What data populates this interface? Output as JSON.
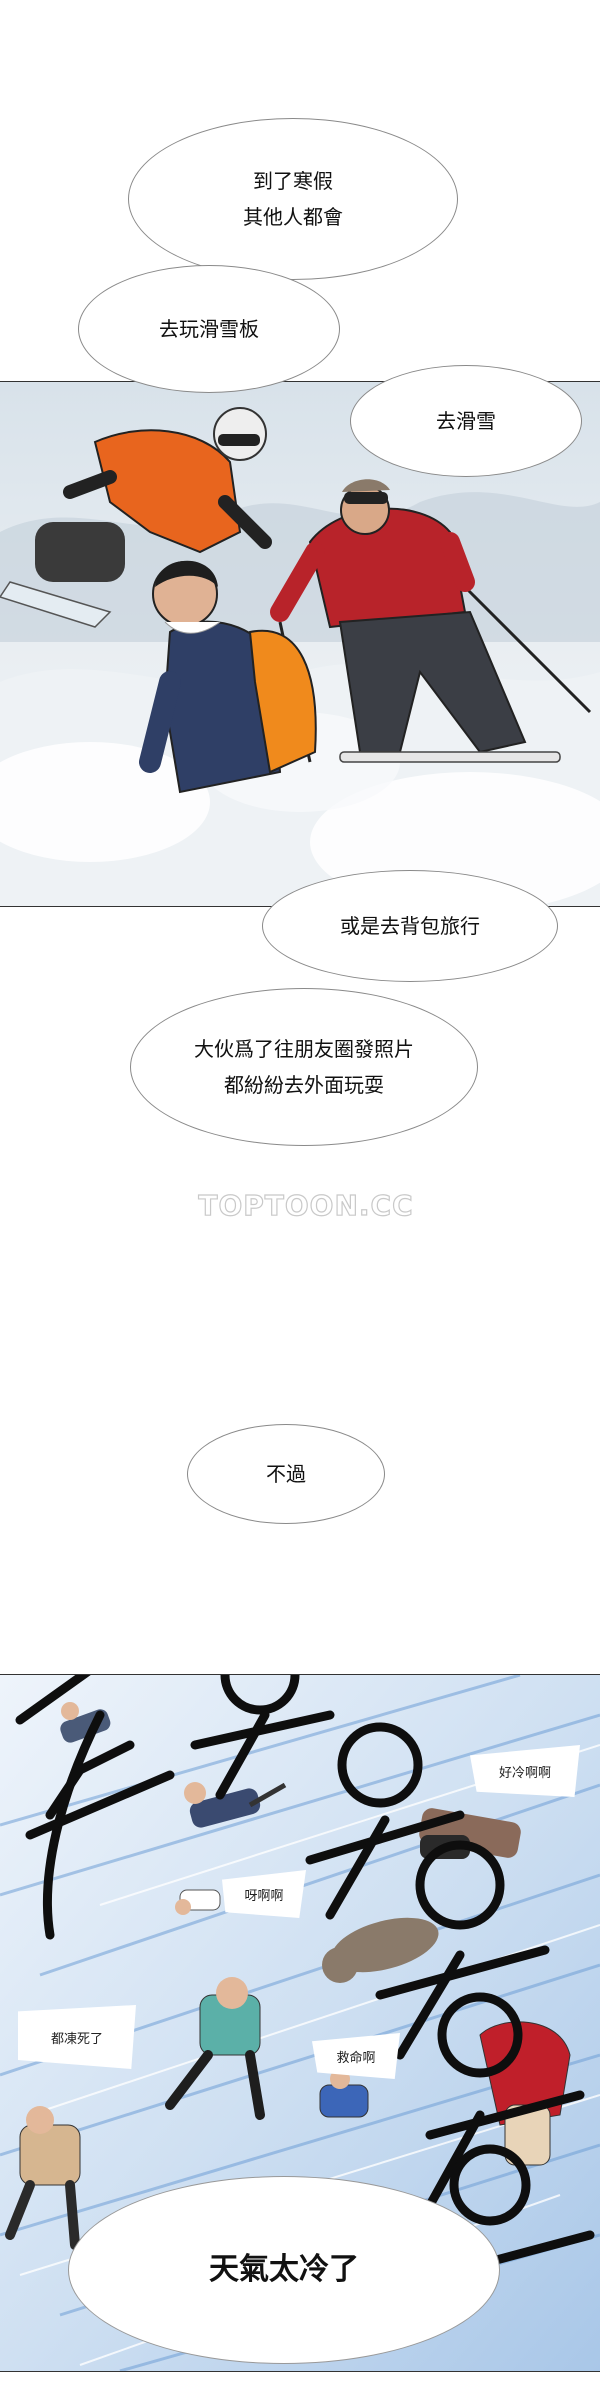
{
  "bubbles": {
    "b1_line1": "到了寒假",
    "b1_line2": "其他人都會",
    "b2": "去玩滑雪板",
    "b3": "去滑雪",
    "b4": "或是去背包旅行",
    "b5_line1": "大伙爲了往朋友圈發照片",
    "b5_line2": "都紛紛去外面玩耍",
    "b6": "不過",
    "b7": "天氣太冷了"
  },
  "small_bubbles": {
    "s1": "好冷啊啊",
    "s2": "呀啊啊",
    "s3": "都凍死了",
    "s4": "救命啊"
  },
  "watermark": "TOPTOON.CC",
  "colors": {
    "snow_sky": "#dfe8ee",
    "orange_jacket": "#e8651e",
    "red_jacket": "#b8232a",
    "navy_jacket": "#2f3f66",
    "orange_pack": "#f08a1c",
    "wind_blue": "#6f9fd6"
  }
}
